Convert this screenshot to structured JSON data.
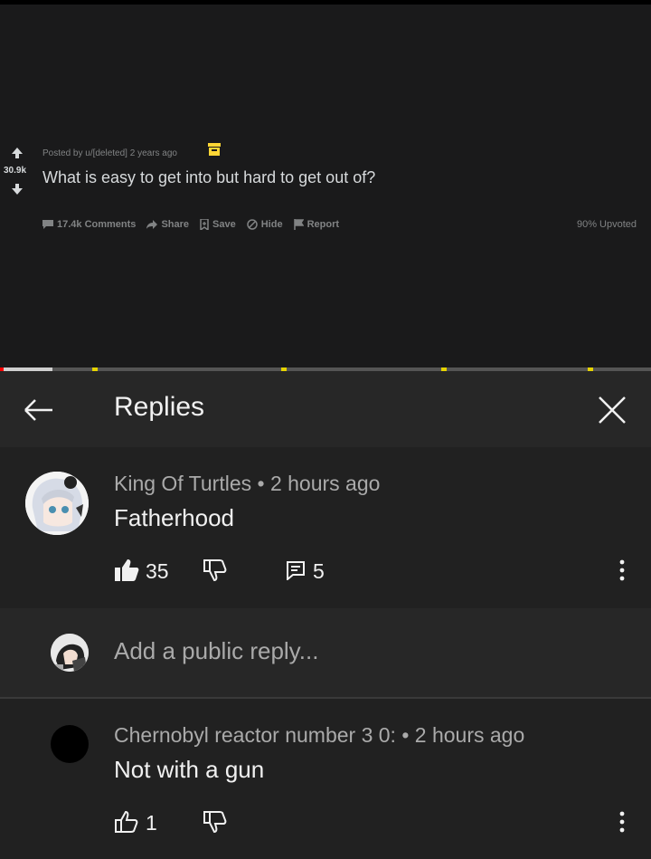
{
  "post": {
    "score": "30.9k",
    "posted_by": "Posted by u/[deleted] 2 years ago",
    "title": "What is easy to get into but hard to get out of?",
    "actions": {
      "comments": "17.4k Comments",
      "share": "Share",
      "save": "Save",
      "hide": "Hide",
      "report": "Report"
    },
    "upvoted": "90% Upvoted"
  },
  "player": {
    "progress_fraction": 0.08,
    "accent_color": "#e6d300"
  },
  "panel": {
    "title": "Replies"
  },
  "comment": {
    "author_line": "King Of Turtles • 2 hours ago",
    "text": "Fatherhood",
    "likes": "35",
    "replies": "5"
  },
  "reply_box": {
    "placeholder": "Add a public reply..."
  },
  "reply": {
    "author_line": "Chernobyl reactor number 3 0: • 2 hours ago",
    "text": "Not with a gun",
    "likes": "1"
  }
}
